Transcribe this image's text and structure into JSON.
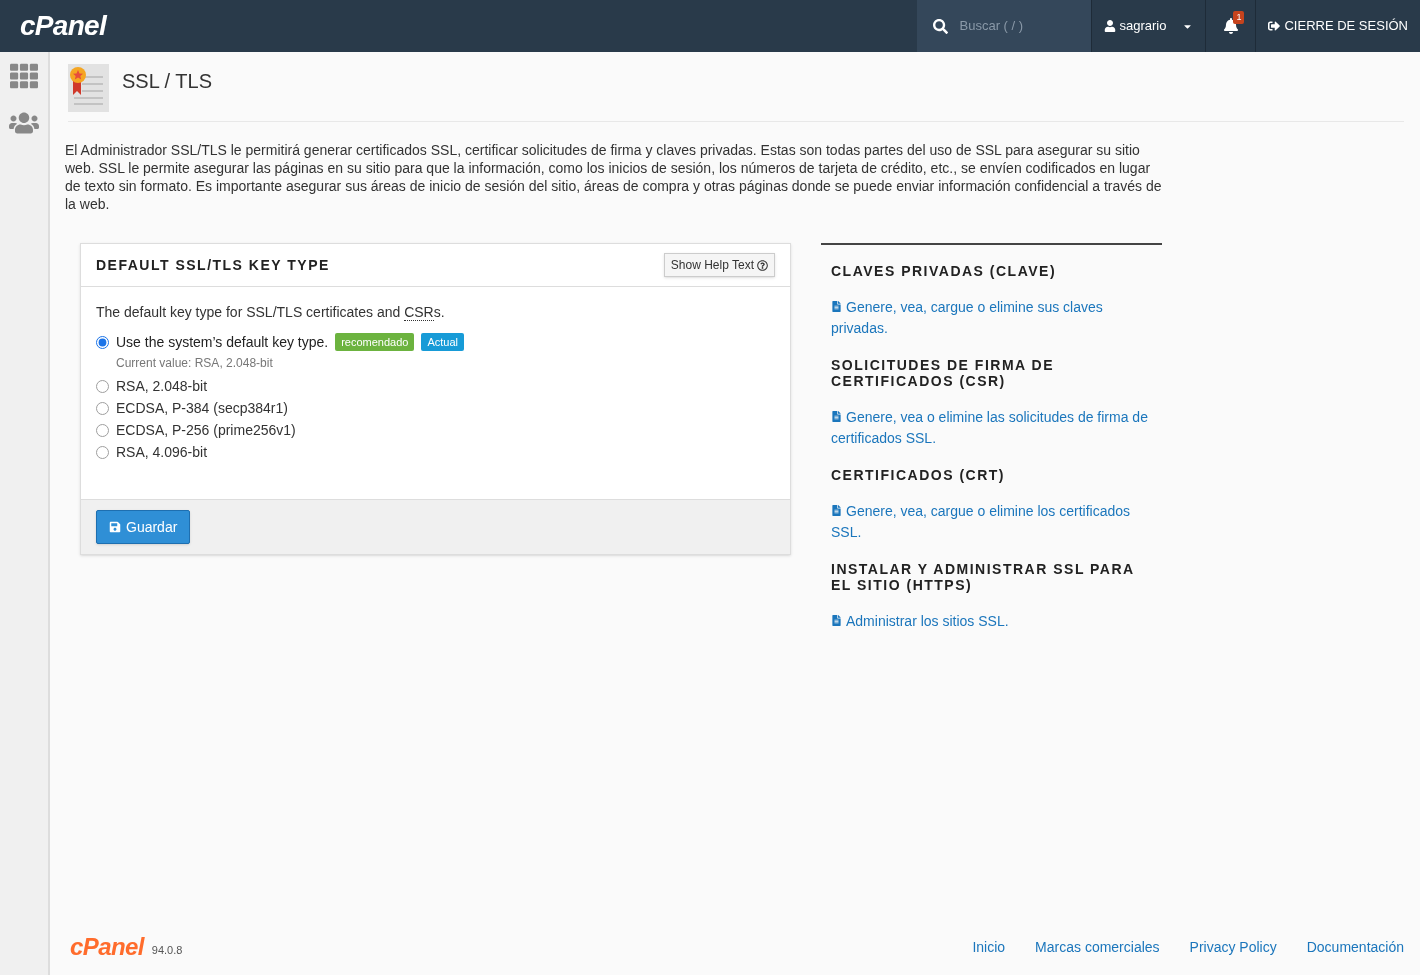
{
  "header": {
    "logo": "cPanel",
    "search": {
      "placeholder": "Buscar ( / )"
    },
    "user": "sagrario",
    "notifications": "1",
    "logout": "CIERRE DE SESIÓN"
  },
  "page": {
    "title": "SSL / TLS",
    "intro": "El Administrador SSL/TLS le permitirá generar certificados SSL, certificar solicitudes de firma y claves privadas. Estas son todas partes del uso de SSL para asegurar su sitio web. SSL le permite asegurar las páginas en su sitio para que la información, como los inicios de sesión, los números de tarjeta de crédito, etc., se envíen codificados en lugar de texto sin formato. Es importante asegurar sus áreas de inicio de sesión del sitio, áreas de compra y otras páginas donde se puede enviar información confidencial a través de la web."
  },
  "panel": {
    "title": "DEFAULT SSL/TLS KEY TYPE",
    "help_button": "Show Help Text",
    "description": "The default key type for SSL/TLS certificates and ",
    "abbr": "CSR",
    "description_end": "s.",
    "options": [
      {
        "label": "Use the system’s default key type.",
        "selected": true,
        "badges": [
          {
            "text": "recomendado",
            "kind": "success"
          },
          {
            "text": "Actual",
            "kind": "info"
          }
        ],
        "note": "Current value: RSA, 2.048-bit"
      },
      {
        "label": "RSA, 2.048-bit",
        "selected": false
      },
      {
        "label": "ECDSA, P-384 (secp384r1)",
        "selected": false
      },
      {
        "label": "ECDSA, P-256 (prime256v1)",
        "selected": false
      },
      {
        "label": "RSA, 4.096-bit",
        "selected": false
      }
    ],
    "save_button": "Guardar"
  },
  "sections": [
    {
      "title": "CLAVES PRIVADAS (CLAVE)",
      "link": "Genere, vea, cargue o elimine sus claves privadas."
    },
    {
      "title": "SOLICITUDES DE FIRMA DE CERTIFICADOS (CSR)",
      "link": "Genere, vea o elimine las solicitudes de firma de certificados SSL."
    },
    {
      "title": "CERTIFICADOS (CRT)",
      "link": "Genere, vea, cargue o elimine los certificados SSL."
    },
    {
      "title": "INSTALAR Y ADMINISTRAR SSL PARA EL SITIO (HTTPS)",
      "link": "Administrar los sitios SSL."
    }
  ],
  "footer": {
    "logo": "cPanel",
    "version": "94.0.8",
    "links": [
      "Inicio",
      "Marcas comerciales",
      "Privacy Policy",
      "Documentación"
    ]
  }
}
